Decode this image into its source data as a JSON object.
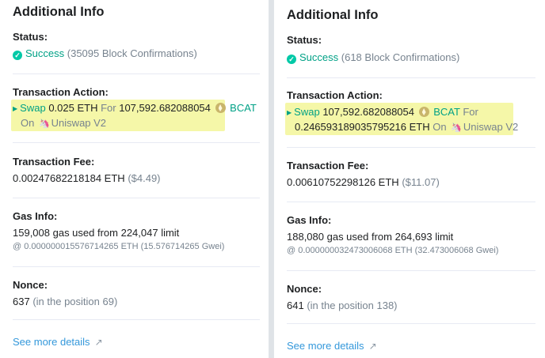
{
  "left": {
    "title": "Additional Info",
    "status_label": "Status:",
    "status_value": "Success",
    "status_confirmations": "(35095 Block Confirmations)",
    "action_label": "Transaction Action:",
    "action_swap": "Swap",
    "action_amount_in": "0.025 ETH",
    "action_for": "For",
    "action_amount_out": "107,592.682088054",
    "action_token": "BCAT",
    "action_on": "On",
    "action_dex": "Uniswap V2",
    "fee_label": "Transaction Fee:",
    "fee_value": "0.00247682218184 ETH",
    "fee_usd": "($4.49)",
    "gas_label": "Gas Info:",
    "gas_used": "159,008 gas used from 224,047 limit",
    "gas_price": "@ 0.000000015576714265 ETH (15.576714265 Gwei)",
    "nonce_label": "Nonce:",
    "nonce_value": "637",
    "nonce_position": "(in the position 69)",
    "more_link": "See more details"
  },
  "right": {
    "title": "Additional Info",
    "status_label": "Status:",
    "status_value": "Success",
    "status_confirmations": "(618 Block Confirmations)",
    "action_label": "Transaction Action:",
    "action_swap": "Swap",
    "action_amount_in": "107,592.682088054",
    "action_token": "BCAT",
    "action_for": "For",
    "action_amount_out": "0.246593189035795216 ETH",
    "action_on": "On",
    "action_dex": "Uniswap V2",
    "fee_label": "Transaction Fee:",
    "fee_value": "0.00610752298126 ETH",
    "fee_usd": "($11.07)",
    "gas_label": "Gas Info:",
    "gas_used": "188,080 gas used from 264,693 limit",
    "gas_price": "@ 0.000000032473006068 ETH (32.473006068 Gwei)",
    "nonce_label": "Nonce:",
    "nonce_value": "641",
    "nonce_position": "(in the position 138)",
    "more_link": "See more details"
  },
  "colors": {
    "success": "#00c9a7",
    "link": "#3498db",
    "highlight": "#f5f7a8"
  },
  "icons": [
    "check-circle-icon",
    "caret-right-icon",
    "bcat-token-icon",
    "uniswap-icon",
    "external-link-icon"
  ]
}
